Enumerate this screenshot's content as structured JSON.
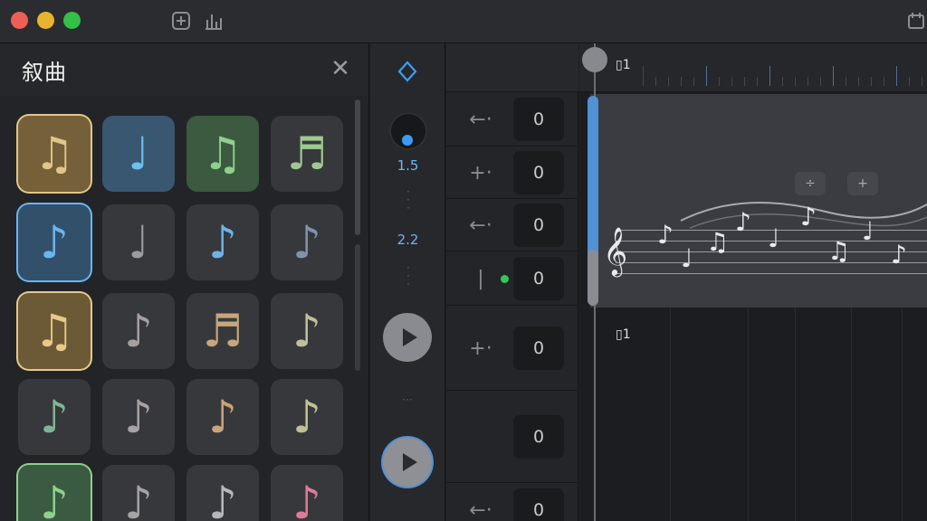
{
  "window": {
    "traffic_lights": {
      "close": "#ec5f57",
      "minimize": "#e8b430",
      "zoom": "#32c146"
    },
    "toolbar_icons": [
      "add-track-icon",
      "mixer-icon",
      "region-edit-icon"
    ]
  },
  "library": {
    "title": "叙曲",
    "close_icon": "close-icon",
    "tiles": [
      {
        "glyph": "♫",
        "color": "#e2c689",
        "bg": "#75603a",
        "selected": true
      },
      {
        "glyph": "♩",
        "color": "#6ec0f2",
        "bg": "#3a5772"
      },
      {
        "glyph": "♫",
        "color": "#8fd08d",
        "bg": "#3c5a40"
      },
      {
        "glyph": "♬",
        "color": "#9dca8f",
        "bg": "#37383c"
      },
      {
        "glyph": "♪",
        "color": "#69b7ef",
        "bg": "#33506b",
        "selected": true
      },
      {
        "glyph": "♩",
        "color": "#9c9ca0",
        "bg": "#37383c"
      },
      {
        "glyph": "♪",
        "color": "#6bb3ea",
        "bg": "#37383c"
      },
      {
        "glyph": "♪",
        "color": "#7f93b0",
        "bg": "#37383c"
      },
      {
        "glyph": "♫",
        "color": "#e8c98a",
        "bg": "#6c5a36",
        "selected": true
      },
      {
        "glyph": "♪",
        "color": "#a59fa0",
        "bg": "#37383c"
      },
      {
        "glyph": "♬",
        "color": "#c8a67a",
        "bg": "#37383c"
      },
      {
        "glyph": "♪",
        "color": "#c0bf9a",
        "bg": "#37383c"
      },
      {
        "glyph": "♪",
        "color": "#7fb596",
        "bg": "#37383c"
      },
      {
        "glyph": "♪",
        "color": "#a7a2a3",
        "bg": "#37383c"
      },
      {
        "glyph": "♪",
        "color": "#c8a47a",
        "bg": "#37383c"
      },
      {
        "glyph": "♪",
        "color": "#c2c093",
        "bg": "#37383c"
      },
      {
        "glyph": "♪",
        "color": "#8fd08d",
        "bg": "#3b5a42",
        "selected": true
      },
      {
        "glyph": "♪",
        "color": "#a7a2a3",
        "bg": "#37383c"
      },
      {
        "glyph": "♪",
        "color": "#b7b7bb",
        "bg": "#37383c"
      },
      {
        "glyph": "♪",
        "color": "#e07a95",
        "bg": "#37383c"
      }
    ]
  },
  "transport": {
    "nudge_icon": "nudge-icon",
    "value_1": "1.5",
    "value_2": "2.2",
    "play_icon": "play-icon"
  },
  "tracks": {
    "rows": [
      {
        "icon": "←·",
        "icon_name": "arrow-left-icon",
        "value": "0"
      },
      {
        "icon": "+·",
        "icon_name": "plus-dashed-icon",
        "value": "0"
      },
      {
        "icon": "←·",
        "icon_name": "arrow-left-icon",
        "value": "0"
      },
      {
        "icon": "|",
        "icon_name": "level-meter-icon",
        "value": "0",
        "status_color": "#35c759"
      },
      {
        "icon": "+·",
        "icon_name": "plus-dashed-icon",
        "value": "0"
      },
      {
        "icon": "",
        "icon_name": "",
        "value": "0"
      },
      {
        "icon": "←·",
        "icon_name": "arrow-left-icon",
        "value": "0"
      }
    ]
  },
  "arrange": {
    "ruler_marker": "▯1",
    "region_label_top": "▯1",
    "region_label_bottom": "▯1",
    "controls": [
      "÷",
      "+"
    ],
    "accent": "#4f92d6"
  }
}
